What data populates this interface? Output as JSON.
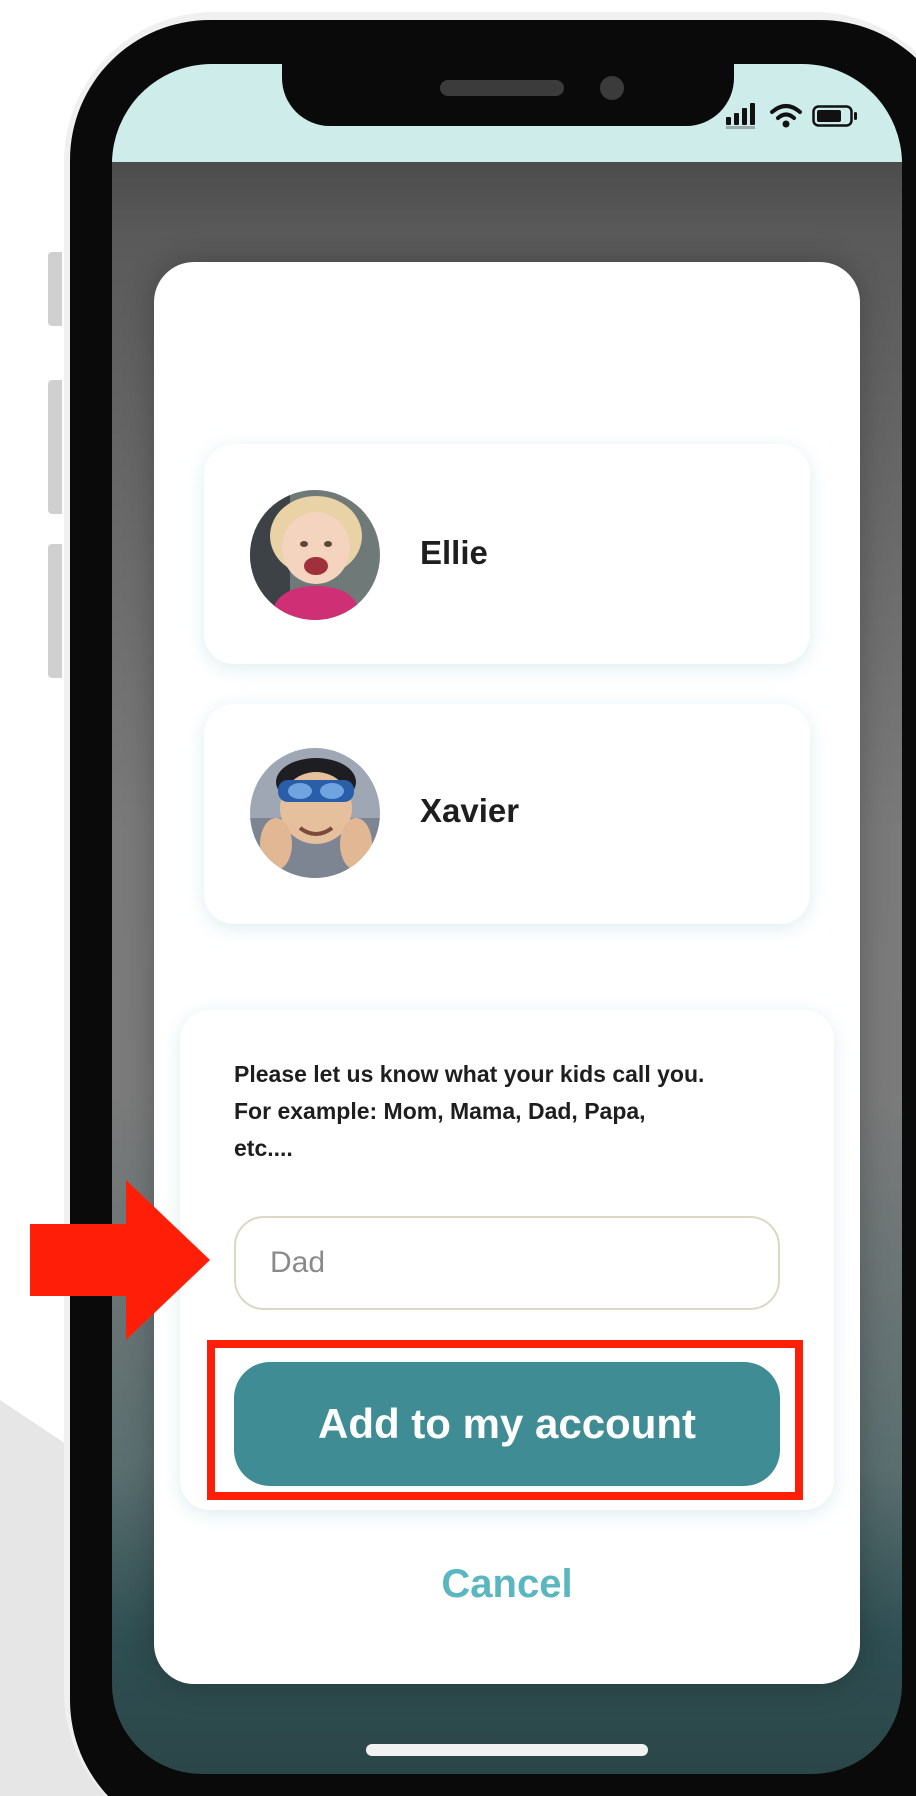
{
  "status_bar": {
    "icons": [
      "cellular-signal-icon",
      "wifi-icon",
      "battery-icon"
    ]
  },
  "kids": [
    {
      "name": "Ellie",
      "avatar": "girl-photo"
    },
    {
      "name": "Xavier",
      "avatar": "boy-with-goggles-photo"
    }
  ],
  "prompt": {
    "line1": "Please let us know what your kids call you.",
    "line2": "For example: Mom, Mama, Dad, Papa,",
    "line3": "etc...."
  },
  "name_input": {
    "value": "",
    "placeholder": "Dad"
  },
  "buttons": {
    "add": "Add to my account",
    "cancel": "Cancel"
  },
  "annotation": {
    "arrow": "red-arrow-icon",
    "highlight_color": "#ff1f08"
  },
  "colors": {
    "accent": "#3f8c94",
    "cancel": "#5ab6bf",
    "status_strip": "#cdecea"
  }
}
